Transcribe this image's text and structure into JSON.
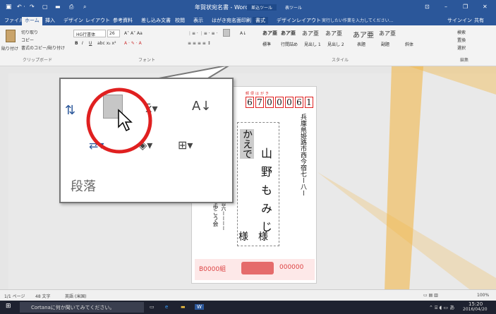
{
  "title": {
    "doc": "年賀状宛名書 - Word",
    "ctx1": "差込ツール",
    "ctx2": "表ツール"
  },
  "tabs": [
    "ファイル",
    "ホーム",
    "挿入",
    "デザイン",
    "レイアウト",
    "参考資料",
    "差し込み文書",
    "校閲",
    "表示",
    "はがき宛名面印刷",
    "書式",
    "デザイン",
    "レイアウト"
  ],
  "tellme": "実行したい作業を入力してください...",
  "signin": "サインイン",
  "share": "共有",
  "clipboard": {
    "cut": "切り取り",
    "copy": "コピー",
    "paste_format": "書式のコピー/貼り付け",
    "paste": "貼り付け",
    "label": "クリップボード"
  },
  "font": {
    "name": "HG行書体",
    "size": "26",
    "label": "フォント"
  },
  "styles": {
    "items": [
      "あア亜",
      "あア亜",
      "あア亜",
      "あア亜",
      "あア亜",
      "あア亜"
    ],
    "names": [
      "標準",
      "行間詰め",
      "見出し 1",
      "見出し 2",
      "表題",
      "副題",
      "斜体"
    ],
    "label": "スタイル"
  },
  "editing": {
    "find": "検索",
    "replace": "置換",
    "select": "選択",
    "label": "編集"
  },
  "zoom_group_label": "段落",
  "postcard": {
    "postal_label": "郵便はがき",
    "zip": [
      "6",
      "7",
      "0",
      "0",
      "0",
      "6",
      "1"
    ],
    "address": "兵庫県姫路市西今宿七ー八ー",
    "names": [
      "かえで",
      "山野もみじ"
    ],
    "sama": [
      "様",
      "様"
    ],
    "sender": "紅葉台六ーーーー",
    "sender2": "群を歩こう会",
    "bottom_left": "B0000組",
    "bottom_right": "000000"
  },
  "status": {
    "page": "1/1 ページ",
    "words": "48 文字",
    "lang": "英語 (米国)",
    "zoom": "100%"
  },
  "taskbar": {
    "cortana": "Cortanaに何か聞いてみてください。",
    "time": "15:20",
    "date": "2016/04/20"
  },
  "colors": {
    "word_blue": "#2b579a",
    "accent_yellow": "#f2b33d",
    "red": "#e02020",
    "stamp_pink": "#e56b6b"
  }
}
